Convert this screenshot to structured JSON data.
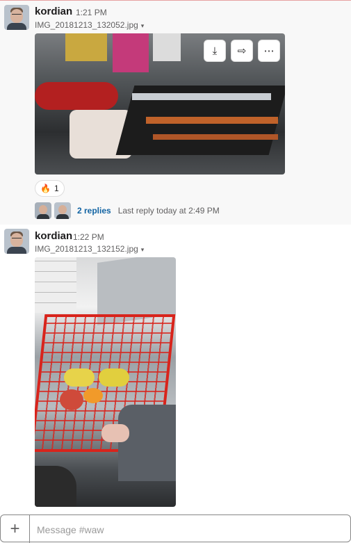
{
  "messages": [
    {
      "author": "kordian",
      "time": "1:21 PM",
      "file": "IMG_20181213_132052.jpg",
      "reaction": {
        "emoji": "🔥",
        "count": "1"
      },
      "thread": {
        "replies": "2 replies",
        "last_reply": "Last reply today at 2:49 PM"
      }
    },
    {
      "author": "kordian",
      "time": "1:22 PM",
      "file": "IMG_20181213_132152.jpg"
    }
  ],
  "composer": {
    "plus": "+",
    "placeholder": "Message #waw"
  },
  "icons": {
    "download": "⤓",
    "share": "⇨",
    "more": "⋯",
    "caret": "▾"
  }
}
